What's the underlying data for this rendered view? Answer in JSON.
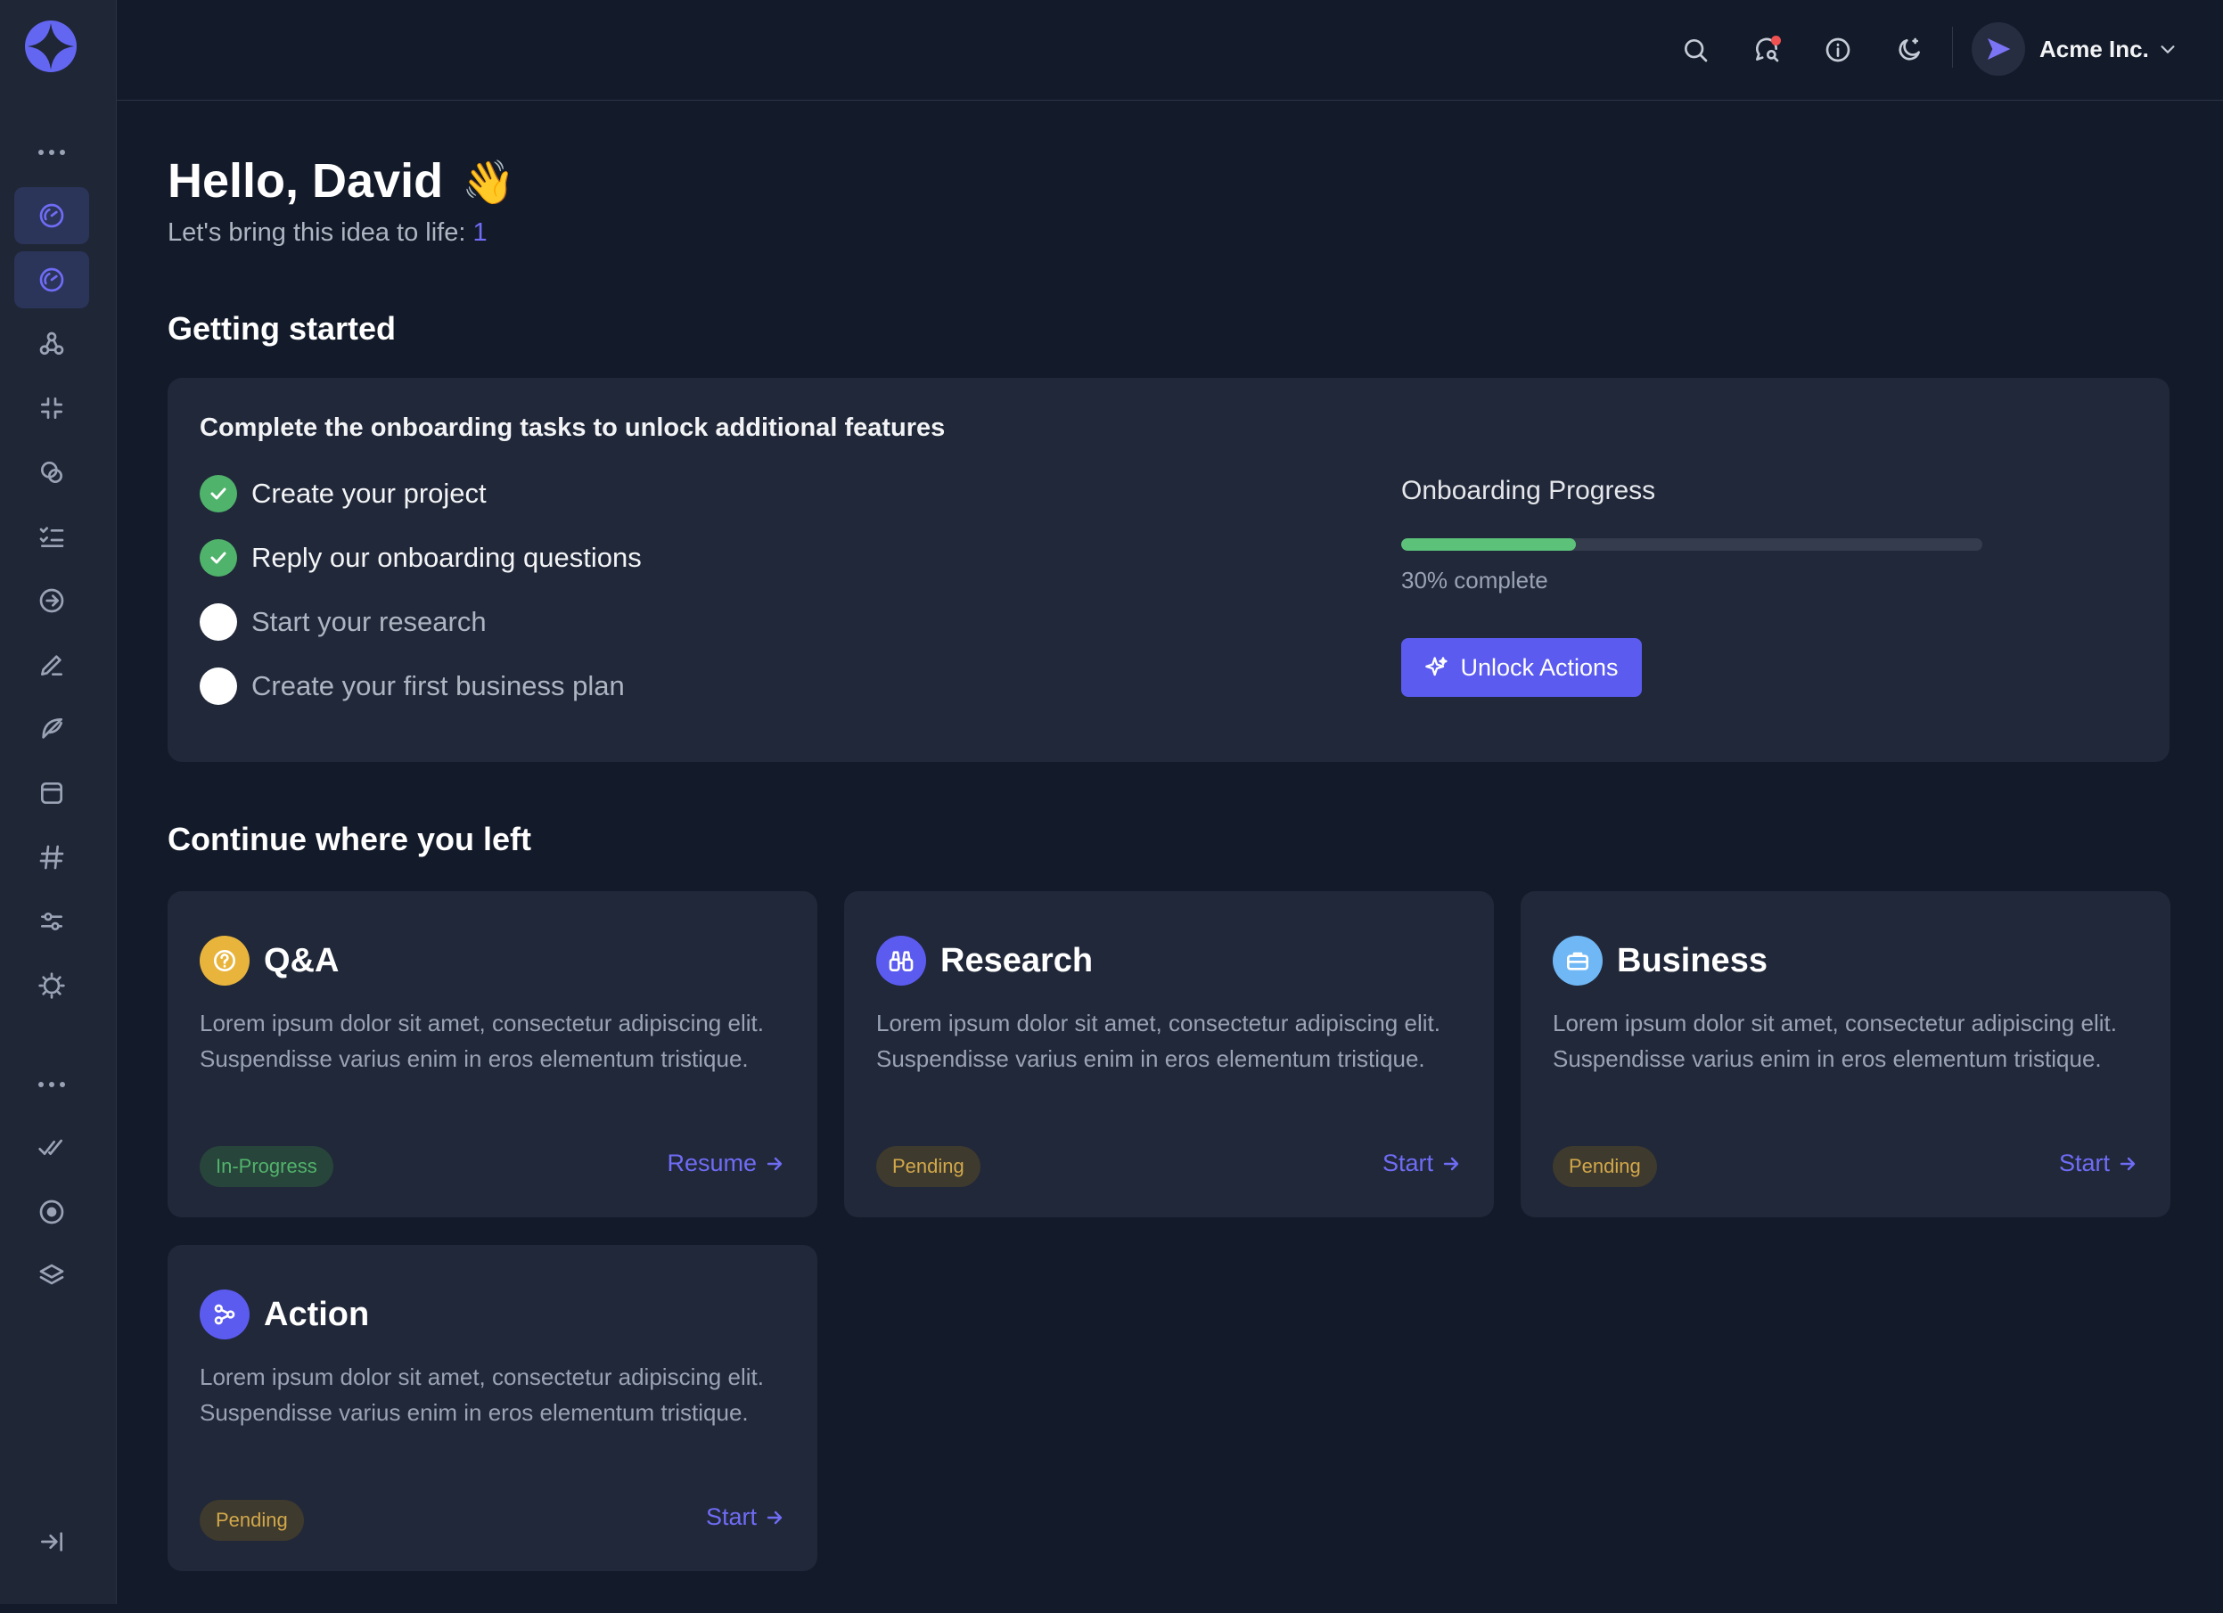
{
  "header": {
    "org_name": "Acme Inc."
  },
  "greeting": {
    "title": "Hello, David",
    "emoji": "👋",
    "subtitle_prefix": "Let's bring this idea to life: ",
    "subtitle_value": "1"
  },
  "getting_started": {
    "heading": "Getting started",
    "card_title": "Complete the onboarding tasks to unlock additional features",
    "tasks": [
      {
        "label": "Create your project",
        "done": true
      },
      {
        "label": "Reply our onboarding questions",
        "done": true
      },
      {
        "label": "Start your research",
        "done": false
      },
      {
        "label": "Create your first business plan",
        "done": false
      }
    ],
    "progress": {
      "title": "Onboarding Progress",
      "percent": 30,
      "text": "30% complete",
      "fill_color": "#5cc27a"
    },
    "unlock_label": "Unlock Actions"
  },
  "continue": {
    "heading": "Continue where you left",
    "cards": [
      {
        "title": "Q&A",
        "icon": "question-circle-icon",
        "icon_color": "#e8b43c",
        "desc": "Lorem ipsum dolor sit amet, consectetur adipiscing elit. Suspendisse varius enim in eros elementum tristique.",
        "status": "In-Progress",
        "action": "Resume"
      },
      {
        "title": "Research",
        "icon": "binoculars-icon",
        "icon_color": "#5b5bf0",
        "desc": "Lorem ipsum dolor sit amet, consectetur adipiscing elit. Suspendisse varius enim in eros elementum tristique.",
        "status": "Pending",
        "action": "Start"
      },
      {
        "title": "Business",
        "icon": "briefcase-icon",
        "icon_color": "#6fb7f5",
        "desc": "Lorem ipsum dolor sit amet, consectetur adipiscing elit. Suspendisse varius enim in eros elementum tristique.",
        "status": "Pending",
        "action": "Start"
      },
      {
        "title": "Action",
        "icon": "share-nodes-icon",
        "icon_color": "#5b5bf0",
        "desc": "Lorem ipsum dolor sit amet, consectetur adipiscing elit. Suspendisse varius enim in eros elementum tristique.",
        "status": "Pending",
        "action": "Start"
      }
    ]
  },
  "colors": {
    "accent": "#5b5bf0",
    "background": "#131a29",
    "card": "#212839",
    "sidebar": "#1f2636"
  }
}
